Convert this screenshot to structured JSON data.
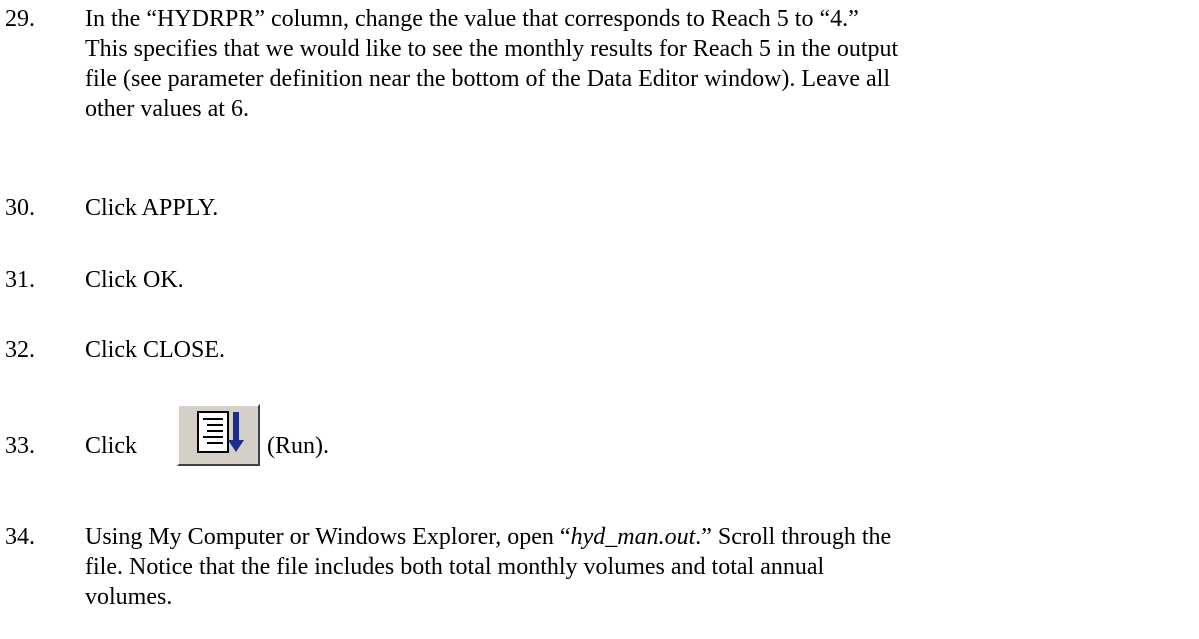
{
  "steps": [
    {
      "number": "29.",
      "lines": [
        "In the “HYDRPR” column, change the value that corresponds to Reach 5 to “4.”",
        "This specifies that we would like to see the monthly results for Reach 5 in the output",
        "file (see parameter definition near the bottom of the Data Editor window).  Leave all",
        "other values at 6."
      ]
    },
    {
      "number": "30.",
      "lines": [
        "Click APPLY."
      ]
    },
    {
      "number": "31.",
      "lines": [
        "Click OK."
      ]
    },
    {
      "number": "32.",
      "lines": [
        "Click CLOSE."
      ]
    },
    {
      "number": "33.",
      "before_icon": "Click",
      "icon": "run-icon",
      "after_icon": "(Run)."
    },
    {
      "number": "34.",
      "line1_prefix": "Using My Computer or Windows Explorer, open “",
      "filename": "hyd_man.out",
      "line1_suffix": ".”  Scroll through the",
      "lines": [
        "file.  Notice that the file includes both total monthly volumes and total annual",
        "volumes."
      ]
    }
  ]
}
